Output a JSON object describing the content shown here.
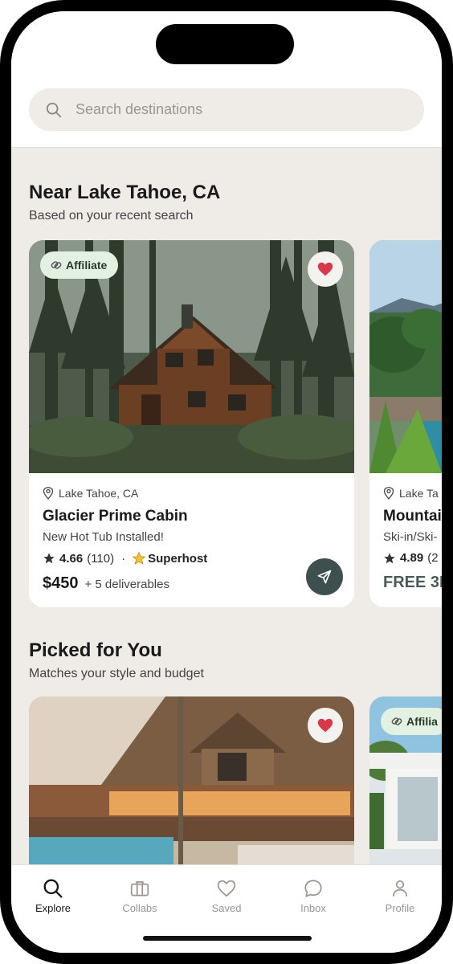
{
  "search": {
    "placeholder": "Search destinations",
    "icon": "search-icon"
  },
  "sections": [
    {
      "title": "Near Lake Tahoe, CA",
      "subtitle": "Based on your recent search",
      "cards": [
        {
          "badge": "Affiliate",
          "favorited": true,
          "location": "Lake Tahoe, CA",
          "title": "Glacier Prime Cabin",
          "subtitle": "New Hot Tub Installed!",
          "rating": "4.66",
          "reviews": "(110)",
          "separator": "·",
          "superhost": "Superhost",
          "price": "$450",
          "deliverables": "+ 5 deliverables"
        },
        {
          "favorited": false,
          "location": "Lake Ta",
          "title": "Mountai",
          "subtitle": "Ski-in/Ski-",
          "rating": "4.89",
          "reviews": "(2",
          "price": "FREE 3D"
        }
      ]
    },
    {
      "title": "Picked for You",
      "subtitle": "Matches your style and budget",
      "cards": [
        {
          "favorited": true
        },
        {
          "badge": "Affilia"
        }
      ]
    }
  ],
  "tabbar": {
    "items": [
      {
        "label": "Explore",
        "icon": "search-icon",
        "active": true
      },
      {
        "label": "Collabs",
        "icon": "briefcase-icon",
        "active": false
      },
      {
        "label": "Saved",
        "icon": "heart-outline-icon",
        "active": false
      },
      {
        "label": "Inbox",
        "icon": "chat-bubble-icon",
        "active": false
      },
      {
        "label": "Profile",
        "icon": "person-icon",
        "active": false
      }
    ]
  },
  "colors": {
    "accent": "#3d4f4e",
    "heart": "#d9384a",
    "badge_bg": "#e3f1e3",
    "feed_bg": "#efebe7"
  }
}
